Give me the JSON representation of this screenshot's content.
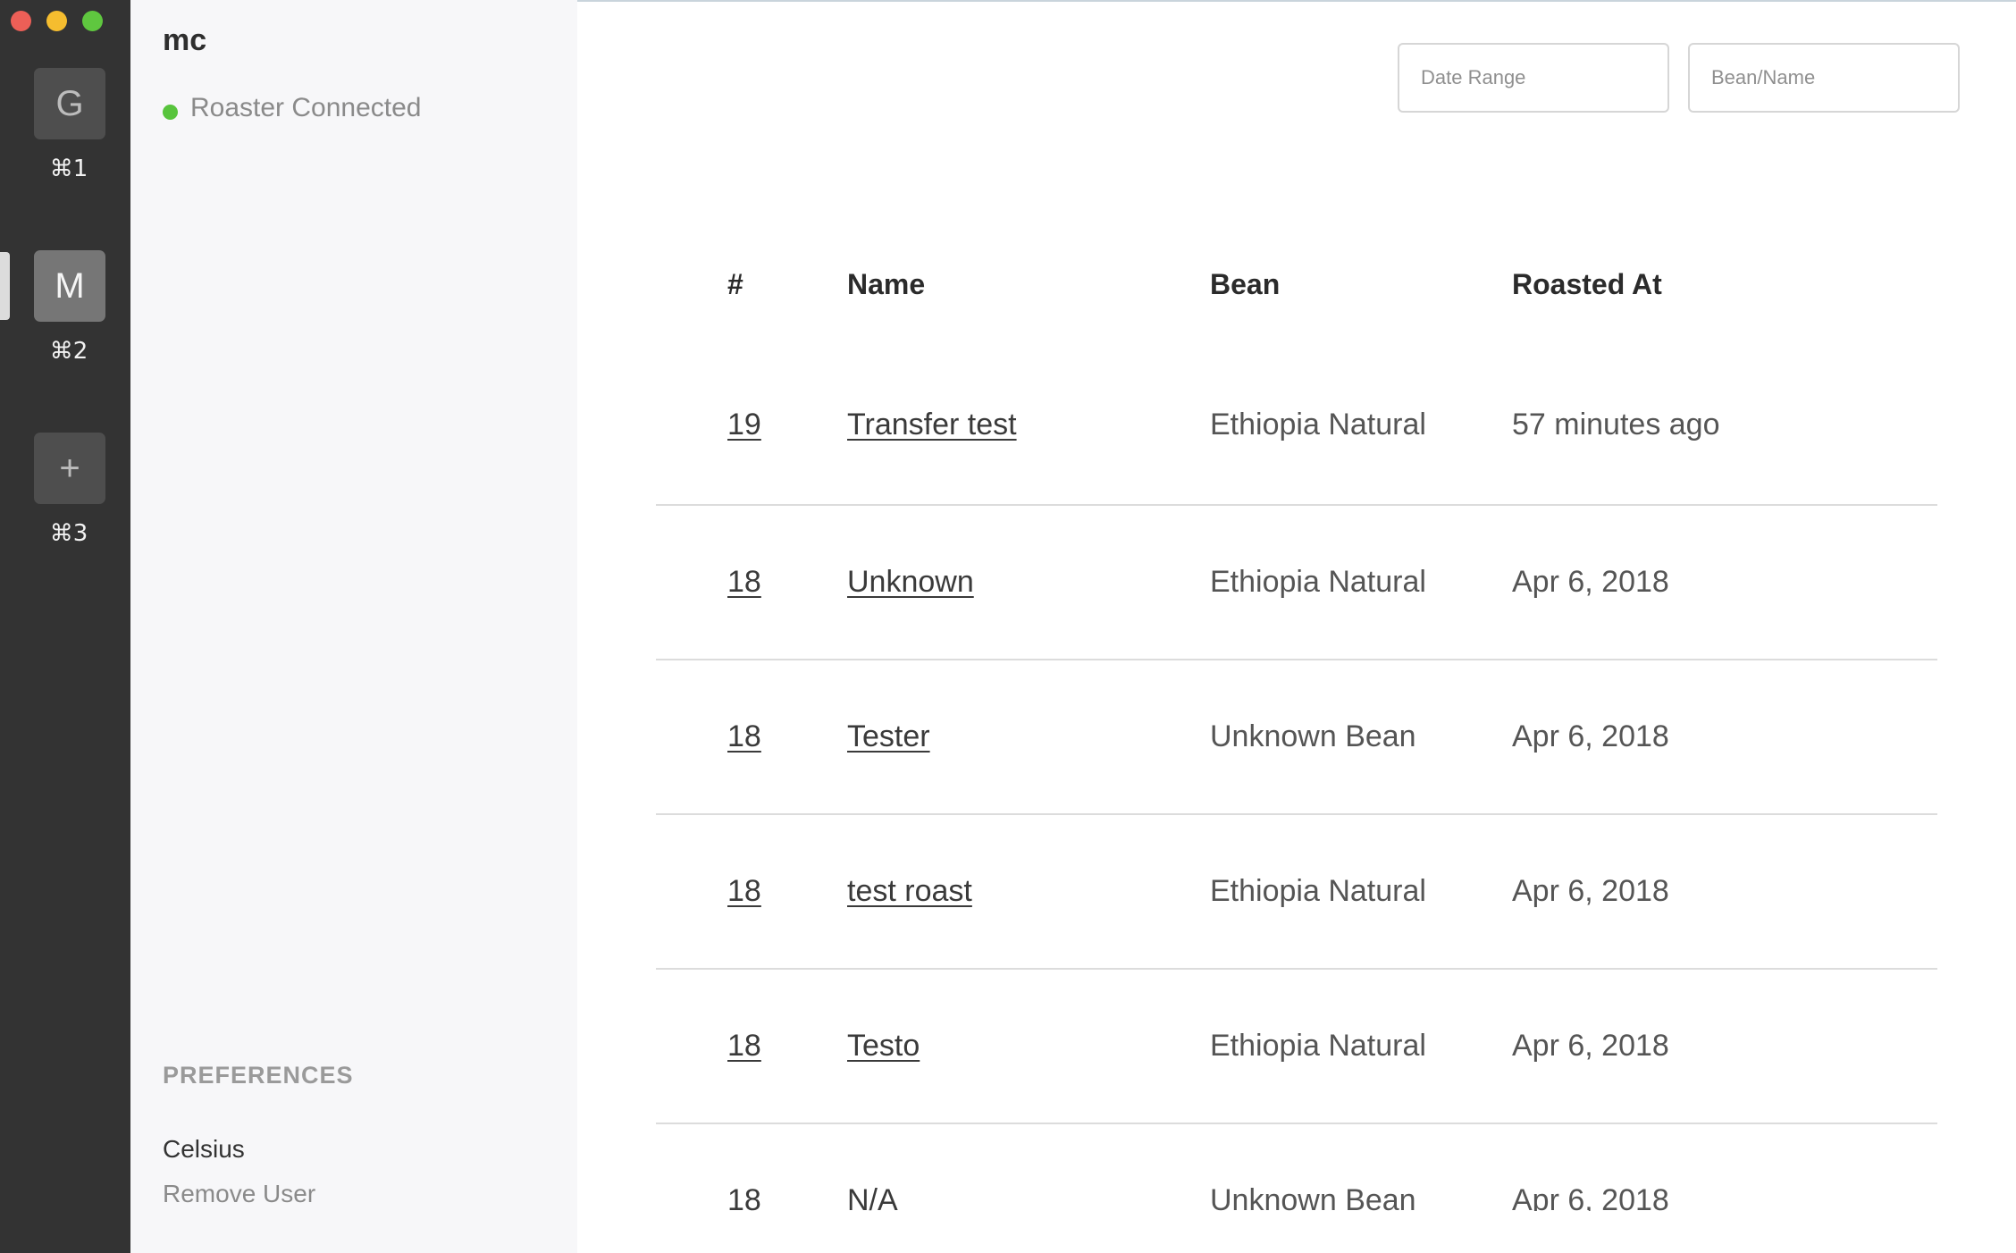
{
  "window": {
    "controls": [
      "close",
      "minimize",
      "maximize"
    ]
  },
  "rail": {
    "items": [
      {
        "letter": "G",
        "shortcut": "⌘1",
        "active": false
      },
      {
        "letter": "M",
        "shortcut": "⌘2",
        "active": true
      },
      {
        "letter": "+",
        "shortcut": "⌘3",
        "active": false
      }
    ]
  },
  "panel": {
    "user": "mc",
    "status": "Roaster Connected",
    "status_color": "#58c43d",
    "preferences_heading": "PREFERENCES",
    "unit_label": "Celsius",
    "remove_user_label": "Remove User"
  },
  "filters": {
    "date_range_placeholder": "Date Range",
    "bean_name_placeholder": "Bean/Name"
  },
  "table": {
    "headers": {
      "num": "#",
      "name": "Name",
      "bean": "Bean",
      "roasted_at": "Roasted At"
    },
    "rows": [
      {
        "num": "19",
        "name": "Transfer test",
        "bean": "Ethiopia Natural",
        "roasted_at": "57 minutes ago"
      },
      {
        "num": "18",
        "name": "Unknown",
        "bean": "Ethiopia Natural",
        "roasted_at": "Apr 6, 2018"
      },
      {
        "num": "18",
        "name": "Tester",
        "bean": "Unknown Bean",
        "roasted_at": "Apr 6, 2018"
      },
      {
        "num": "18",
        "name": "test roast",
        "bean": "Ethiopia Natural",
        "roasted_at": "Apr 6, 2018"
      },
      {
        "num": "18",
        "name": "Testo",
        "bean": "Ethiopia Natural",
        "roasted_at": "Apr 6, 2018"
      },
      {
        "num": "18",
        "name": "N/A",
        "bean": "Unknown Bean",
        "roasted_at": "Apr 6, 2018"
      }
    ]
  }
}
